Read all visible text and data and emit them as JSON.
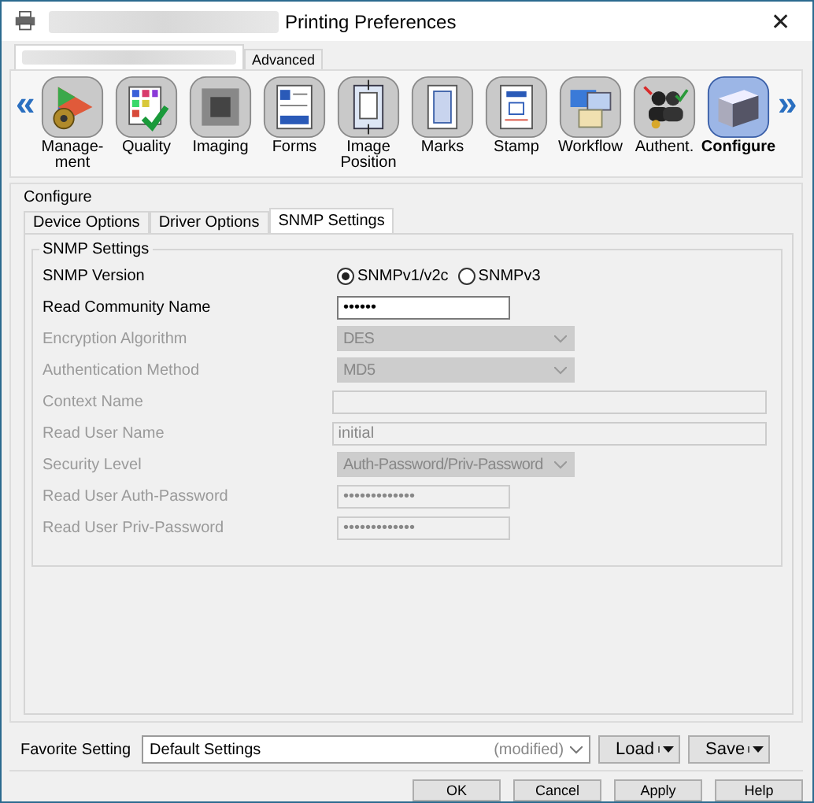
{
  "window": {
    "title": "Printing Preferences",
    "close": "✕"
  },
  "top_tabs": [
    {
      "kind": "redacted",
      "selected": true
    },
    {
      "kind": "label",
      "label": "Advanced",
      "selected": false
    }
  ],
  "nav": {
    "prev": "«",
    "next": "»"
  },
  "categories": [
    {
      "label": "Manage-ment",
      "selected": false
    },
    {
      "label": "Quality",
      "selected": false
    },
    {
      "label": "Imaging",
      "selected": false
    },
    {
      "label": "Forms",
      "selected": false
    },
    {
      "label": "Image Position",
      "selected": false
    },
    {
      "label": "Marks",
      "selected": false
    },
    {
      "label": "Stamp",
      "selected": false
    },
    {
      "label": "Workflow",
      "selected": false
    },
    {
      "label": "Authent.",
      "selected": false
    },
    {
      "label": "Configure",
      "selected": true
    }
  ],
  "section": "Configure",
  "sub_tabs": [
    {
      "label": "Device Options",
      "selected": false
    },
    {
      "label": "Driver Options",
      "selected": false
    },
    {
      "label": "SNMP Settings",
      "selected": true
    }
  ],
  "group": "SNMP Settings",
  "rows": [
    {
      "label": "SNMP Version",
      "kind": "radio",
      "disabled": false,
      "options": [
        {
          "label": "SNMPv1/v2c",
          "selected": true
        },
        {
          "label": "SNMPv3",
          "selected": false
        }
      ]
    },
    {
      "label": "Read Community Name",
      "kind": "password",
      "disabled": false,
      "value": "••••••"
    },
    {
      "label": "Encryption Algorithm",
      "kind": "combo",
      "disabled": true,
      "value": "DES"
    },
    {
      "label": "Authentication Method",
      "kind": "combo",
      "disabled": true,
      "value": "MD5"
    },
    {
      "label": "Context Name",
      "kind": "text",
      "disabled": true
    },
    {
      "label": "Read User Name",
      "kind": "text",
      "disabled": true,
      "value": "initial"
    },
    {
      "label": "Security Level",
      "kind": "combo",
      "disabled": true,
      "value": "Auth-Password/Priv-Password"
    },
    {
      "label": "Read User Auth-Password",
      "kind": "password",
      "disabled": true,
      "value": "•••••••••••••"
    },
    {
      "label": "Read User Priv-Password",
      "kind": "password",
      "disabled": true,
      "value": "•••••••••••••"
    }
  ],
  "favorite": {
    "label": "Favorite Setting",
    "value": "Default Settings",
    "note": "(modified)",
    "buttons": [
      "Load",
      "Save"
    ]
  },
  "buttons": [
    "OK",
    "Cancel",
    "Apply",
    "Help"
  ]
}
